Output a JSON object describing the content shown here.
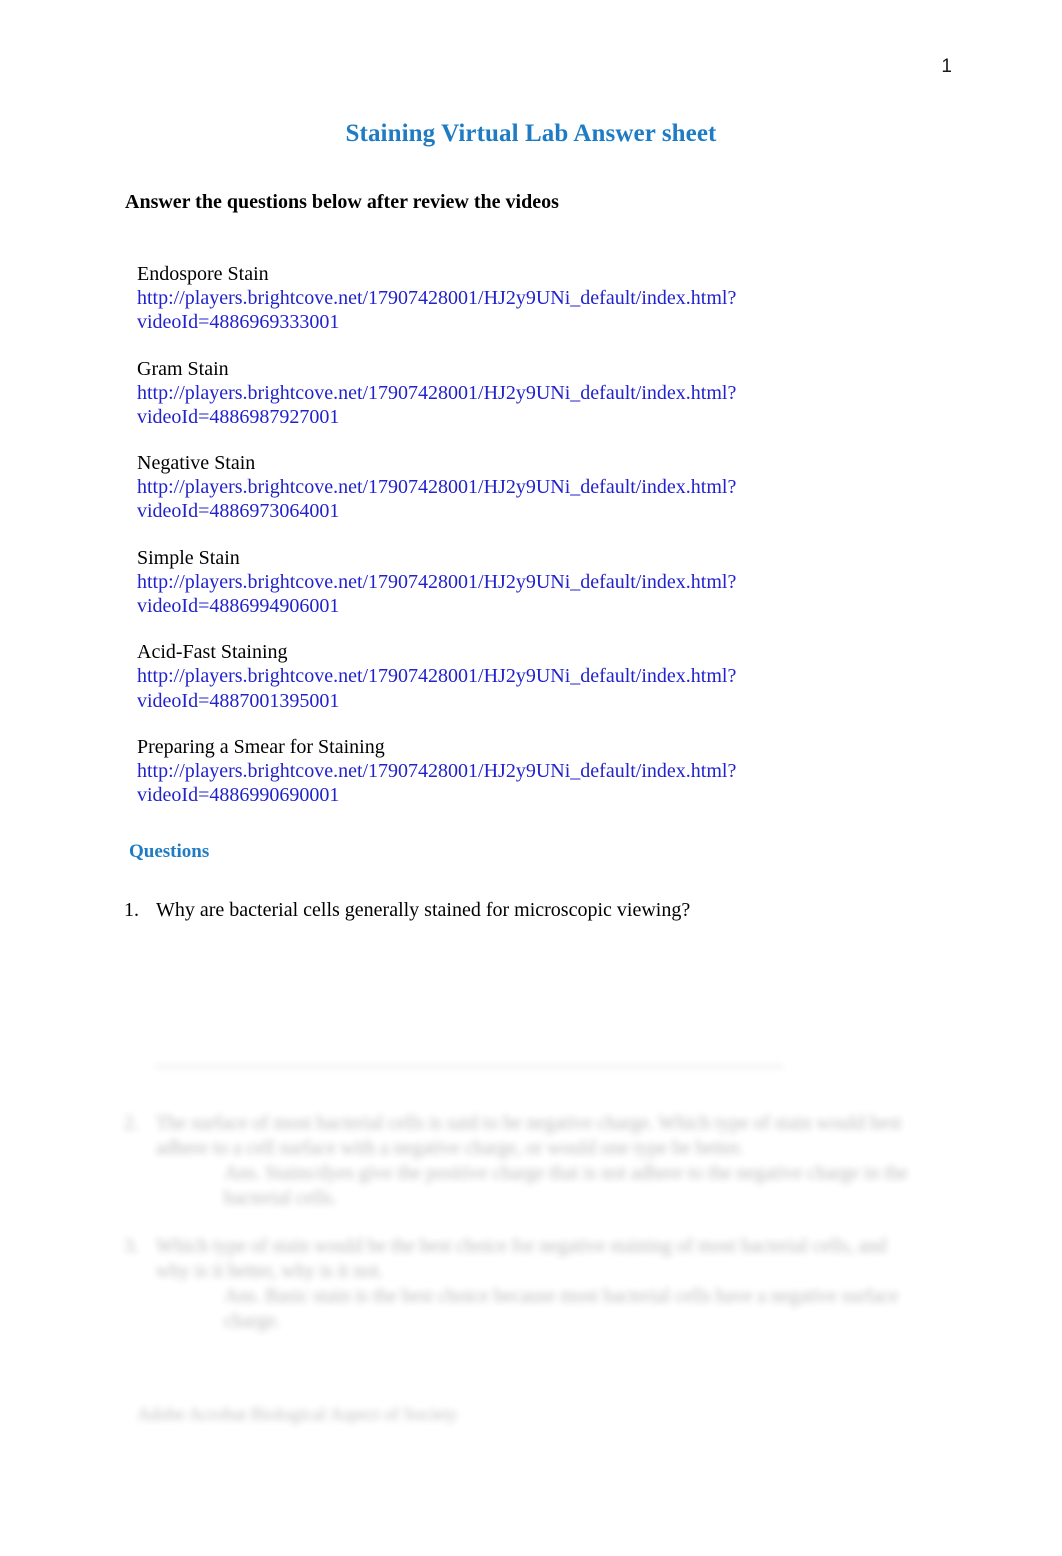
{
  "document": {
    "page_number": "1",
    "title": "Staining Virtual Lab Answer sheet",
    "instruction": "Answer the questions below after review the videos"
  },
  "videos": [
    {
      "label": "Endospore Stain",
      "url_line1": "http://players.brightcove.net/17907428001/HJ2y9UNi_default/index.html?",
      "url_line2": "videoId=4886969333001"
    },
    {
      "label": "Gram Stain",
      "url_line1": "http://players.brightcove.net/17907428001/HJ2y9UNi_default/index.html?",
      "url_line2": "videoId=4886987927001"
    },
    {
      "label": "Negative Stain",
      "url_line1": "http://players.brightcove.net/17907428001/HJ2y9UNi_default/index.html?",
      "url_line2": "videoId=4886973064001"
    },
    {
      "label": "Simple Stain",
      "url_line1": "http://players.brightcove.net/17907428001/HJ2y9UNi_default/index.html?",
      "url_line2": "videoId=4886994906001"
    },
    {
      "label": "Acid-Fast Staining",
      "url_line1": "http://players.brightcove.net/17907428001/HJ2y9UNi_default/index.html?",
      "url_line2": "videoId=4887001395001"
    },
    {
      "label": "Preparing a Smear for Staining",
      "url_line1": "http://players.brightcove.net/17907428001/HJ2y9UNi_default/index.html?",
      "url_line2": "videoId=4886990690001"
    }
  ],
  "questions_section": {
    "heading": "Questions",
    "question_1": {
      "number": "1.",
      "text": "Why are bacterial cells generally stained for microscopic viewing?"
    }
  },
  "blurred_preview": {
    "question_2": {
      "number": "2.",
      "question": "The surface of most bacterial cells is said to be negative charge. Which type of stain would best adhere to a cell surface with a negative charge, or would one type be better.",
      "answer": "Ans.  Stains/dyes give the positive charge that is not adhere to the negative charge in the bacterial cells."
    },
    "question_3": {
      "number": "3.",
      "question": "Which type of stain would be the best choice for negative staining of most bacterial cells, and why is it better, why is it not.",
      "answer": "Ans.  Basic stain is the best choice because most bacterial cells have a negative surface charge."
    },
    "footer": "Adobe Acrobat Biological Aspect of Society"
  },
  "colors": {
    "title_blue": "#1f7cc4",
    "link_blue": "#2222cc",
    "heading_blue": "#1f7cc4",
    "body_black": "#000000",
    "page_background": "#ffffff"
  }
}
